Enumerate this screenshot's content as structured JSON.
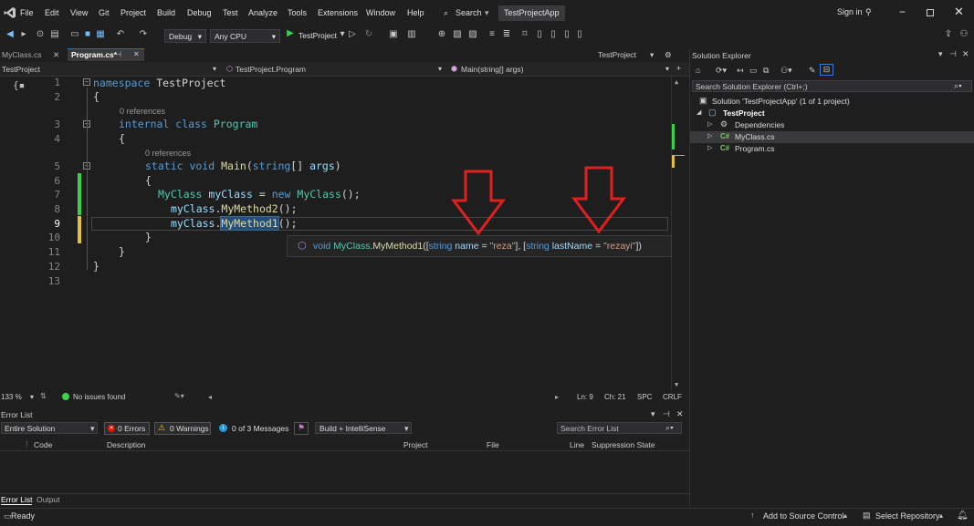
{
  "menubar": {
    "items": [
      "File",
      "Edit",
      "View",
      "Git",
      "Project",
      "Build",
      "Debug",
      "Test",
      "Analyze",
      "Tools",
      "Extensions",
      "Window",
      "Help"
    ],
    "search_label": "Search",
    "active_app": "TestProjectApp",
    "sign_in": "Sign in"
  },
  "toolbar": {
    "config": "Debug",
    "platform": "Any CPU",
    "run_target": "TestProject"
  },
  "tabs": {
    "tab1": "MyClass.cs",
    "tab2": "Program.cs*",
    "right_label": "TestProject"
  },
  "navbar": {
    "project": "TestProject",
    "class": "TestProject.Program",
    "member": "Main(string[] args)"
  },
  "code": {
    "line_numbers": [
      "1",
      "2",
      "3",
      "4",
      "5",
      "6",
      "7",
      "8",
      "9",
      "10",
      "11",
      "12",
      "13"
    ],
    "references_1": "0 references",
    "references_2": "0 references"
  },
  "tooltip": {
    "void": "void",
    "class": "MyClass",
    "method": "MyMethod1",
    "p1_type": "string",
    "p1_name": "name",
    "p1_default": "\"reza\"",
    "p2_type": "string",
    "p2_name": "lastName",
    "p2_default": "\"rezayi\""
  },
  "editor_status": {
    "zoom": "133 %",
    "issues": "No issues found",
    "line": "Ln: 9",
    "ch": "Ch: 21",
    "spc": "SPC",
    "crlf": "CRLF"
  },
  "errorlist": {
    "title": "Error List",
    "scope": "Entire Solution",
    "errors": "0 Errors",
    "warnings": "0 Warnings",
    "messages": "0 of 3 Messages",
    "build": "Build + IntelliSense",
    "search_placeholder": "Search Error List",
    "columns": [
      "Code",
      "Description",
      "Project",
      "File",
      "Line",
      "Suppression State"
    ],
    "bottom_tabs": [
      "Error List",
      "Output"
    ]
  },
  "solution": {
    "title": "Solution Explorer",
    "search_placeholder": "Search Solution Explorer (Ctrl+;)",
    "solution_label": "Solution 'TestProjectApp' (1 of 1 project)",
    "project": "TestProject",
    "items": [
      "Dependencies",
      "MyClass.cs",
      "Program.cs"
    ]
  },
  "statusbar": {
    "ready": "Ready",
    "source_control": "Add to Source Control",
    "repo": "Select Repository"
  },
  "colors": {
    "accent": "#007acc",
    "arrow_red": "#e02020",
    "keyword": "#569cd6",
    "type": "#4ec9b0",
    "method": "#dcdcaa"
  }
}
